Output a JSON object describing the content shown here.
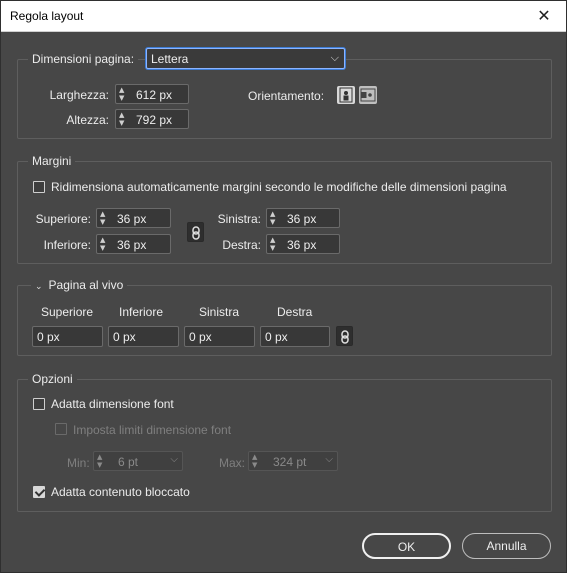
{
  "window": {
    "title": "Regola layout",
    "close_glyph": "✕"
  },
  "page_size": {
    "label": "Dimensioni pagina:",
    "selected": "Lettera",
    "width_label": "Larghezza:",
    "width_value": "612 px",
    "height_label": "Altezza:",
    "height_value": "792 px",
    "orientation_label": "Orientamento:",
    "orientation_selected": "portrait"
  },
  "margins": {
    "legend": "Margini",
    "auto_resize_label": "Ridimensiona automaticamente margini secondo le modifiche delle dimensioni pagina",
    "auto_resize_checked": false,
    "top_label": "Superiore:",
    "top_value": "36 px",
    "bottom_label": "Inferiore:",
    "bottom_value": "36 px",
    "left_label": "Sinistra:",
    "left_value": "36 px",
    "right_label": "Destra:",
    "right_value": "36 px"
  },
  "bleed": {
    "legend": "Pagina al vivo",
    "disclosure_glyph": "⌄",
    "top_label": "Superiore",
    "bottom_label": "Inferiore",
    "left_label": "Sinistra",
    "right_label": "Destra",
    "top_value": "0 px",
    "bottom_value": "0 px",
    "left_value": "0 px",
    "right_value": "0 px"
  },
  "options": {
    "legend": "Opzioni",
    "fit_font_label": "Adatta dimensione font",
    "fit_font_checked": false,
    "font_limits_label": "Imposta limiti dimensione font",
    "font_limits_checked": false,
    "min_label": "Min:",
    "min_value": "6 pt",
    "max_label": "Max:",
    "max_value": "324 pt",
    "fit_locked_label": "Adatta contenuto bloccato",
    "fit_locked_checked": true
  },
  "buttons": {
    "ok": "OK",
    "cancel": "Annulla"
  },
  "icons": {
    "spin_up": "▲",
    "spin_down": "▼",
    "chevron_down": "⌵"
  },
  "colors": {
    "background": "#474747",
    "focus_ring": "#3d7dd6"
  }
}
